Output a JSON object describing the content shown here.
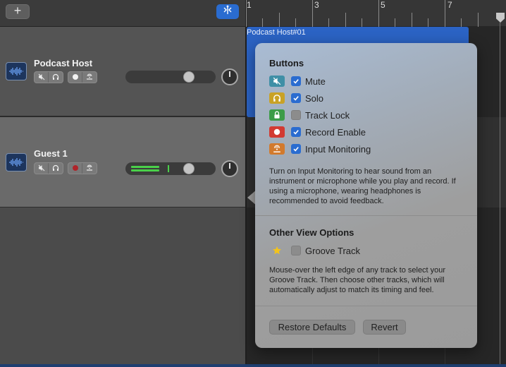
{
  "toolbar": {
    "add_label": "+"
  },
  "tracks": [
    {
      "name": "Podcast Host"
    },
    {
      "name": "Guest 1"
    }
  ],
  "ruler": {
    "labels": [
      "1",
      "3",
      "5",
      "7"
    ]
  },
  "region": {
    "label": "Podcast Host#01"
  },
  "popover": {
    "buttons_title": "Buttons",
    "options": [
      {
        "label": "Mute",
        "checked": true,
        "icon": "mute-icon",
        "color": "#3f8fa6"
      },
      {
        "label": "Solo",
        "checked": true,
        "icon": "headphones-icon",
        "color": "#c9a225"
      },
      {
        "label": "Track Lock",
        "checked": false,
        "icon": "lock-icon",
        "color": "#3c9c48"
      },
      {
        "label": "Record Enable",
        "checked": true,
        "icon": "record-icon",
        "color": "#d23a32"
      },
      {
        "label": "Input Monitoring",
        "checked": true,
        "icon": "input-monitoring-icon",
        "color": "#d27a2d"
      }
    ],
    "buttons_desc": "Turn on Input Monitoring to hear sound from an instrument or microphone while you play and record. If using a microphone, wearing headphones is recommended to avoid feedback.",
    "other_title": "Other View Options",
    "groove": {
      "label": "Groove Track",
      "checked": false,
      "icon": "star-icon"
    },
    "other_desc": "Mouse-over the left edge of any track to select your Groove Track. Then choose other tracks, which will automatically adjust to match its timing and feel.",
    "restore_label": "Restore Defaults",
    "revert_label": "Revert"
  }
}
